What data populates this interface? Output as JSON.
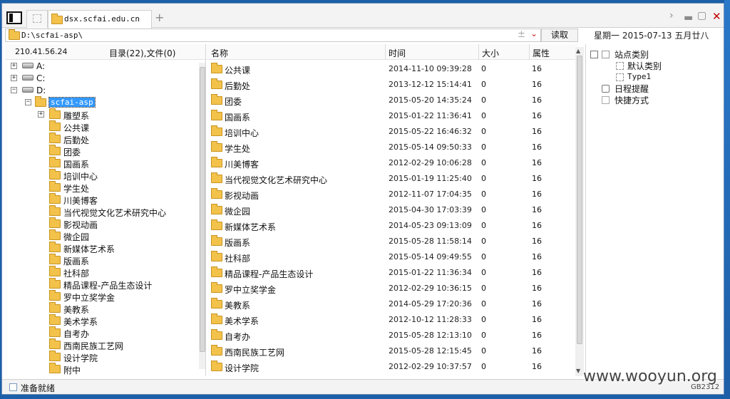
{
  "tab": {
    "title": "dsx.scfai.edu.cn"
  },
  "address": {
    "path": "D:\\scfai-asp\\",
    "read_button": "读取"
  },
  "date_display": "星期一 2015-07-13 五月廿八",
  "left_header": {
    "ip": "210.41.56.24",
    "counts": "目录(22),文件(0)"
  },
  "tree": {
    "drives": [
      "A:",
      "C:",
      "D:"
    ],
    "selected": "scfai-asp",
    "folders": [
      "雕塑系",
      "公共课",
      "后勤处",
      "团委",
      "国画系",
      "培训中心",
      "学生处",
      "川美博客",
      "当代视觉文化艺术研究中心",
      "影视动画",
      "微企园",
      "新媒体艺术系",
      "版画系",
      "社科部",
      "精品课程-产品生态设计",
      "罗中立奖学金",
      "美教系",
      "美术学系",
      "自考办",
      "西南民族工艺网",
      "设计学院",
      "附中"
    ]
  },
  "columns": {
    "name": "名称",
    "time": "时间",
    "size": "大小",
    "attr": "属性"
  },
  "files": [
    {
      "name": "公共课",
      "time": "2014-11-10 09:39:28",
      "size": "0",
      "attr": "16"
    },
    {
      "name": "后勤处",
      "time": "2013-12-12 15:14:41",
      "size": "0",
      "attr": "16"
    },
    {
      "name": "团委",
      "time": "2015-05-20 14:35:24",
      "size": "0",
      "attr": "16"
    },
    {
      "name": "国画系",
      "time": "2015-01-22 11:36:41",
      "size": "0",
      "attr": "16"
    },
    {
      "name": "培训中心",
      "time": "2015-05-22 16:46:32",
      "size": "0",
      "attr": "16"
    },
    {
      "name": "学生处",
      "time": "2015-05-14 09:50:33",
      "size": "0",
      "attr": "16"
    },
    {
      "name": "川美博客",
      "time": "2012-02-29 10:06:28",
      "size": "0",
      "attr": "16"
    },
    {
      "name": "当代视觉文化艺术研究中心",
      "time": "2015-01-19 11:25:40",
      "size": "0",
      "attr": "16"
    },
    {
      "name": "影视动画",
      "time": "2012-11-07 17:04:35",
      "size": "0",
      "attr": "16"
    },
    {
      "name": "微企园",
      "time": "2015-04-30 17:03:39",
      "size": "0",
      "attr": "16"
    },
    {
      "name": "新媒体艺术系",
      "time": "2014-05-23 09:13:09",
      "size": "0",
      "attr": "16"
    },
    {
      "name": "版画系",
      "time": "2015-05-28 11:58:14",
      "size": "0",
      "attr": "16"
    },
    {
      "name": "社科部",
      "time": "2015-05-14 09:49:55",
      "size": "0",
      "attr": "16"
    },
    {
      "name": "精品课程-产品生态设计",
      "time": "2015-01-22 11:36:34",
      "size": "0",
      "attr": "16"
    },
    {
      "name": "罗中立奖学金",
      "time": "2012-02-29 10:36:15",
      "size": "0",
      "attr": "16"
    },
    {
      "name": "美教系",
      "time": "2014-05-29 17:20:36",
      "size": "0",
      "attr": "16"
    },
    {
      "name": "美术学系",
      "time": "2012-10-12 11:28:33",
      "size": "0",
      "attr": "16"
    },
    {
      "name": "自考办",
      "time": "2015-05-28 12:13:10",
      "size": "0",
      "attr": "16"
    },
    {
      "name": "西南民族工艺网",
      "time": "2015-05-28 12:15:45",
      "size": "0",
      "attr": "16"
    },
    {
      "name": "设计学院",
      "time": "2012-02-29 10:37:57",
      "size": "0",
      "attr": "16"
    }
  ],
  "right_panel": {
    "site_category": "站点类别",
    "default_category": "默认类别",
    "type1": "Type1",
    "schedule": "日程提醒",
    "shortcuts": "快捷方式"
  },
  "status": {
    "text": "准备就绪",
    "encoding": "GB2312"
  },
  "watermark": "www.wooyun.org"
}
